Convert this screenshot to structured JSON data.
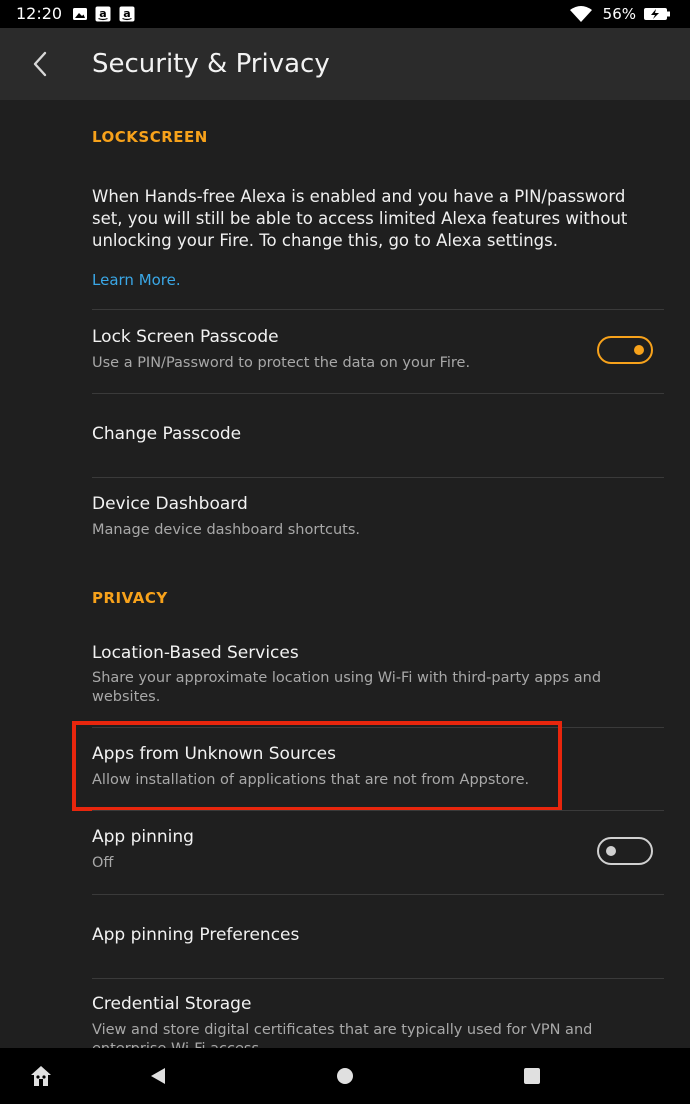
{
  "status_bar": {
    "time": "12:20",
    "battery_percent": "56%"
  },
  "header": {
    "title": "Security & Privacy"
  },
  "lockscreen": {
    "section_title": "LOCKSCREEN",
    "description": "When Hands-free Alexa is enabled and you have a PIN/password set, you will still be able to access limited Alexa features without unlocking your Fire. To change this, go to Alexa settings.",
    "learn_more": "Learn More.",
    "lock_screen_passcode": {
      "title": "Lock Screen Passcode",
      "subtitle": "Use a PIN/Password to protect the data on your Fire.",
      "toggle_on": true
    },
    "change_passcode": {
      "title": "Change Passcode"
    },
    "device_dashboard": {
      "title": "Device Dashboard",
      "subtitle": "Manage device dashboard shortcuts."
    }
  },
  "privacy": {
    "section_title": "PRIVACY",
    "location_services": {
      "title": "Location-Based Services",
      "subtitle": "Share your approximate location using Wi-Fi with third-party apps and websites."
    },
    "unknown_sources": {
      "title": "Apps from Unknown Sources",
      "subtitle": "Allow installation of applications that are not from Appstore."
    },
    "app_pinning": {
      "title": "App pinning",
      "subtitle": "Off",
      "toggle_on": false
    },
    "app_pinning_prefs": {
      "title": "App pinning Preferences"
    },
    "credential_storage": {
      "title": "Credential Storage",
      "subtitle": "View and store digital certificates that are typically used for VPN and enterprise Wi-Fi access."
    }
  },
  "colors": {
    "accent": "#f7a21b",
    "link": "#3aa7e6",
    "highlight": "#e8260d",
    "background": "#1f1f1f",
    "app_bar": "#2b2b2b"
  },
  "icons": {
    "back": "chevron-left-icon",
    "nav_home": "home-icon",
    "nav_back": "triangle-back-icon",
    "nav_circle": "circle-home-icon",
    "nav_recents": "square-recents-icon"
  }
}
